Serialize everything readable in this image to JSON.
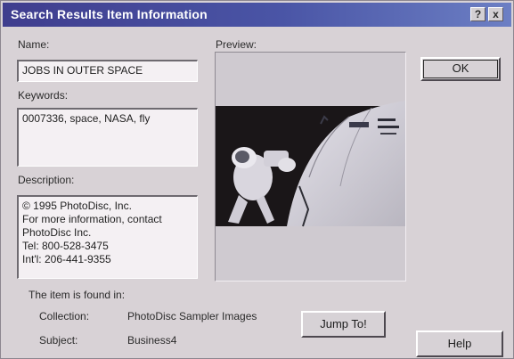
{
  "window": {
    "title": "Search Results Item Information",
    "help_button": "?",
    "close_button": "x"
  },
  "name": {
    "label": "Name:",
    "value": "JOBS IN OUTER SPACE"
  },
  "keywords": {
    "label": "Keywords:",
    "value": "0007336, space, NASA, fly"
  },
  "description": {
    "label": "Description:",
    "lines": [
      "© 1995 PhotoDisc, Inc.",
      "For more information,  contact",
      "PhotoDisc Inc.",
      "Tel: 800-528-3475",
      "Int'l: 206-441-9355"
    ]
  },
  "preview": {
    "label": "Preview:",
    "image_subject": "astronaut spacewalk beside spacecraft"
  },
  "location": {
    "heading": "The item is found in:",
    "collection_label": "Collection:",
    "collection_value": "PhotoDisc Sampler Images",
    "subject_label": "Subject:",
    "subject_value": "Business4"
  },
  "buttons": {
    "ok": "OK",
    "jump": "Jump To!",
    "help": "Help"
  },
  "colors": {
    "titlebar": "#3f3d8e",
    "dialog": "#d8d2d6"
  }
}
